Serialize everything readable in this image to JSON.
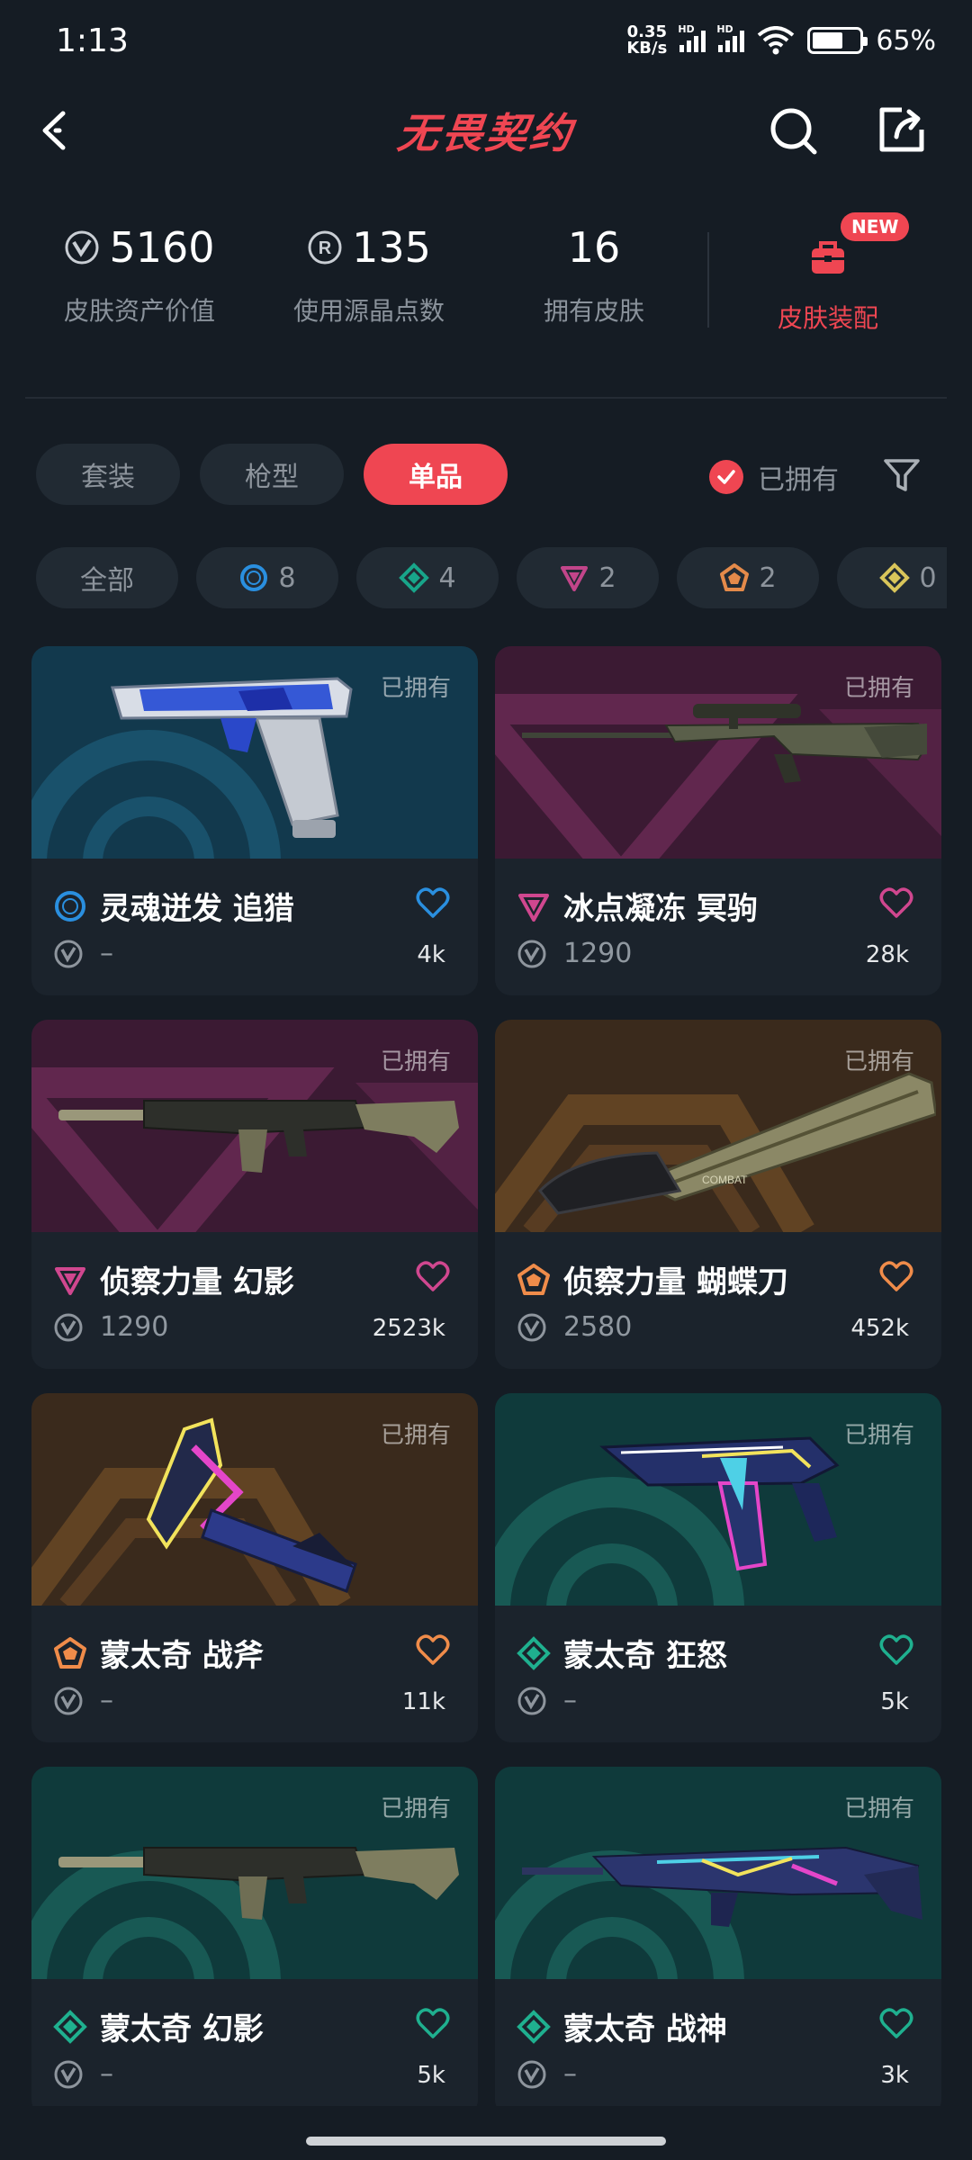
{
  "status_bar": {
    "time": "1:13",
    "net_speed_value": "0.35",
    "net_speed_unit": "KB/s",
    "battery_text": "65%",
    "battery_level": 0.65
  },
  "header": {
    "title": "无畏契约"
  },
  "stats": {
    "asset_value": "5160",
    "asset_label": "皮肤资产价值",
    "radianite_value": "135",
    "radianite_label": "使用源晶点数",
    "owned_value": "16",
    "owned_label": "拥有皮肤",
    "equip_badge": "NEW",
    "equip_label": "皮肤装配"
  },
  "tabs": [
    {
      "label": "套装"
    },
    {
      "label": "枪型"
    },
    {
      "label": "单品"
    }
  ],
  "owned_filter_label": "已拥有",
  "rarity_chips": [
    {
      "label": "全部"
    },
    {
      "label": "8",
      "icon": "select-tier-icon",
      "color": "#2a8fdf"
    },
    {
      "label": "4",
      "icon": "deluxe-tier-icon",
      "color": "#18a58a"
    },
    {
      "label": "2",
      "icon": "premium-tier-icon",
      "color": "#c2458a"
    },
    {
      "label": "2",
      "icon": "exclusive-tier-icon",
      "color": "#e48a4a"
    },
    {
      "label": "0",
      "icon": "ultra-tier-icon",
      "color": "#d9c55a"
    }
  ],
  "cards": [
    {
      "owned": "已拥有",
      "name": "灵魂迸发 追猎",
      "price": "–",
      "likes": "4k",
      "tier": "select",
      "tier_color": "#2a8fdf",
      "heart_color": "#2a8fdf",
      "weapon_icon": "pistol-icon"
    },
    {
      "owned": "已拥有",
      "name": "冰点凝冻 冥驹",
      "price": "1290",
      "likes": "28k",
      "tier": "premium",
      "tier_color": "#d0478f",
      "heart_color": "#d0478f",
      "weapon_icon": "sniper-icon"
    },
    {
      "owned": "已拥有",
      "name": "侦察力量 幻影",
      "price": "1290",
      "likes": "2523k",
      "tier": "premium",
      "tier_color": "#d0478f",
      "heart_color": "#d0478f",
      "weapon_icon": "rifle-icon"
    },
    {
      "owned": "已拥有",
      "name": "侦察力量 蝴蝶刀",
      "price": "2580",
      "likes": "452k",
      "tier": "exclusive",
      "tier_color": "#f08c4a",
      "heart_color": "#f08c4a",
      "weapon_icon": "butterfly-knife-icon"
    },
    {
      "owned": "已拥有",
      "name": "蒙太奇 战斧",
      "price": "–",
      "likes": "11k",
      "tier": "exclusive",
      "tier_color": "#f08c4a",
      "heart_color": "#f08c4a",
      "weapon_icon": "axe-icon"
    },
    {
      "owned": "已拥有",
      "name": "蒙太奇 狂怒",
      "price": "–",
      "likes": "5k",
      "tier": "deluxe",
      "tier_color": "#1fb08f",
      "heart_color": "#1fb08f",
      "weapon_icon": "smg-icon"
    },
    {
      "owned": "已拥有",
      "name": "蒙太奇 幻影",
      "price": "–",
      "likes": "5k",
      "tier": "deluxe",
      "tier_color": "#1fb08f",
      "heart_color": "#1fb08f",
      "weapon_icon": "rifle-icon"
    },
    {
      "owned": "已拥有",
      "name": "蒙太奇 战神",
      "price": "–",
      "likes": "3k",
      "tier": "deluxe",
      "tier_color": "#1fb08f",
      "heart_color": "#1fb08f",
      "weapon_icon": "machine-gun-icon"
    }
  ]
}
